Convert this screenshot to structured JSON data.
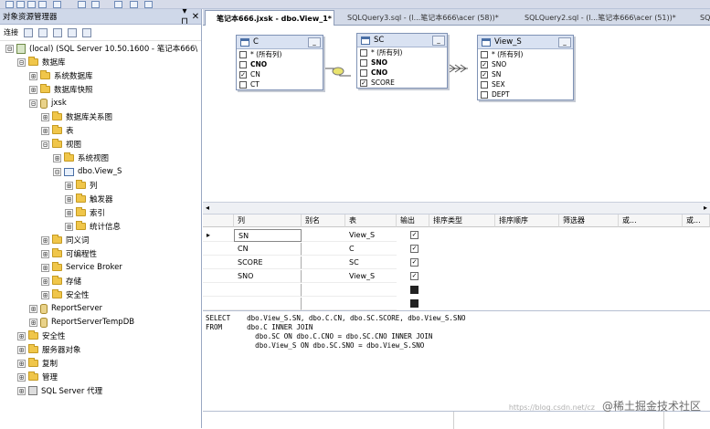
{
  "explorer": {
    "title": "对象资源管理器",
    "pin": "▾ ⊓",
    "close": "✕",
    "connect_label": "连接"
  },
  "tree": [
    {
      "label": "(local) (SQL Server 10.50.1600 - 笔记本666\\",
      "exp": "⊟",
      "icon": "srv",
      "indent": 0
    },
    {
      "label": "数据库",
      "exp": "⊟",
      "icon": "fold",
      "indent": 1
    },
    {
      "label": "系统数据库",
      "exp": "⊞",
      "icon": "fold",
      "indent": 2
    },
    {
      "label": "数据库快照",
      "exp": "⊞",
      "icon": "fold",
      "indent": 2
    },
    {
      "label": "jxsk",
      "exp": "⊟",
      "icon": "db",
      "indent": 2
    },
    {
      "label": "数据库关系图",
      "exp": "⊞",
      "icon": "fold",
      "indent": 3
    },
    {
      "label": "表",
      "exp": "⊞",
      "icon": "fold",
      "indent": 3
    },
    {
      "label": "视图",
      "exp": "⊟",
      "icon": "fold",
      "indent": 3
    },
    {
      "label": "系统视图",
      "exp": "⊞",
      "icon": "fold",
      "indent": 4
    },
    {
      "label": "dbo.View_S",
      "exp": "⊟",
      "icon": "view",
      "indent": 4
    },
    {
      "label": "列",
      "exp": "⊞",
      "icon": "fold",
      "indent": 5
    },
    {
      "label": "触发器",
      "exp": "⊞",
      "icon": "fold",
      "indent": 5
    },
    {
      "label": "索引",
      "exp": "⊞",
      "icon": "fold",
      "indent": 5
    },
    {
      "label": "统计信息",
      "exp": "⊞",
      "icon": "fold",
      "indent": 5
    },
    {
      "label": "同义词",
      "exp": "⊞",
      "icon": "fold",
      "indent": 3
    },
    {
      "label": "可编程性",
      "exp": "⊞",
      "icon": "fold",
      "indent": 3
    },
    {
      "label": "Service Broker",
      "exp": "⊞",
      "icon": "fold",
      "indent": 3
    },
    {
      "label": "存储",
      "exp": "⊞",
      "icon": "fold",
      "indent": 3
    },
    {
      "label": "安全性",
      "exp": "⊞",
      "icon": "fold",
      "indent": 3
    },
    {
      "label": "ReportServer",
      "exp": "⊞",
      "icon": "db",
      "indent": 2
    },
    {
      "label": "ReportServerTempDB",
      "exp": "⊞",
      "icon": "db",
      "indent": 2
    },
    {
      "label": "安全性",
      "exp": "⊞",
      "icon": "fold",
      "indent": 1
    },
    {
      "label": "服务器对象",
      "exp": "⊞",
      "icon": "fold",
      "indent": 1
    },
    {
      "label": "复制",
      "exp": "⊞",
      "icon": "fold",
      "indent": 1
    },
    {
      "label": "管理",
      "exp": "⊞",
      "icon": "fold",
      "indent": 1
    },
    {
      "label": "SQL Server 代理",
      "exp": "⊞",
      "icon": "agent",
      "indent": 1
    }
  ],
  "tabs": [
    {
      "label": "笔记本666.jxsk - dbo.View_1*",
      "active": true
    },
    {
      "label": "SQLQuery3.sql - (l...笔记本666\\acer (58))*",
      "active": false
    },
    {
      "label": "SQLQuery2.sql - (l...笔记本666\\acer (51))*",
      "active": false
    },
    {
      "label": "SQLQu",
      "active": false
    }
  ],
  "diagram_tables": [
    {
      "name": "C",
      "columns": [
        {
          "label": "* (所有列)",
          "checked": false,
          "bold": false
        },
        {
          "label": "CNO",
          "checked": false,
          "bold": true
        },
        {
          "label": "CN",
          "checked": true,
          "bold": false
        },
        {
          "label": "CT",
          "checked": false,
          "bold": false
        }
      ]
    },
    {
      "name": "SC",
      "columns": [
        {
          "label": "* (所有列)",
          "checked": false,
          "bold": false
        },
        {
          "label": "SNO",
          "checked": false,
          "bold": true
        },
        {
          "label": "CNO",
          "checked": false,
          "bold": true
        },
        {
          "label": "SCORE",
          "checked": true,
          "bold": false
        }
      ]
    },
    {
      "name": "View_S",
      "columns": [
        {
          "label": "* (所有列)",
          "checked": false,
          "bold": false
        },
        {
          "label": "SNO",
          "checked": true,
          "bold": false
        },
        {
          "label": "SN",
          "checked": true,
          "bold": false
        },
        {
          "label": "SEX",
          "checked": false,
          "bold": false
        },
        {
          "label": "DEPT",
          "checked": false,
          "bold": false
        }
      ]
    }
  ],
  "grid": {
    "headers": [
      "列",
      "别名",
      "表",
      "输出",
      "排序类型",
      "排序顺序",
      "筛选器",
      "或...",
      "或..."
    ],
    "rows": [
      {
        "col": "SN",
        "alias": "",
        "table": "View_S",
        "output": "checked"
      },
      {
        "col": "CN",
        "alias": "",
        "table": "C",
        "output": "checked"
      },
      {
        "col": "SCORE",
        "alias": "",
        "table": "SC",
        "output": "checked"
      },
      {
        "col": "SNO",
        "alias": "",
        "table": "View_S",
        "output": "checked"
      },
      {
        "col": "",
        "alias": "",
        "table": "",
        "output": "empty"
      },
      {
        "col": "",
        "alias": "",
        "table": "",
        "output": "empty"
      }
    ]
  },
  "sql": [
    "SELECT    dbo.View_S.SN, dbo.C.CN, dbo.SC.SCORE, dbo.View_S.SNO",
    "FROM      dbo.C INNER JOIN",
    "            dbo.SC ON dbo.C.CNO = dbo.SC.CNO INNER JOIN",
    "            dbo.View_S ON dbo.SC.SNO = dbo.View_S.SNO"
  ],
  "watermark": {
    "url": "https://blog.csdn.net/cz",
    "text": "@稀土掘金技术社区"
  }
}
